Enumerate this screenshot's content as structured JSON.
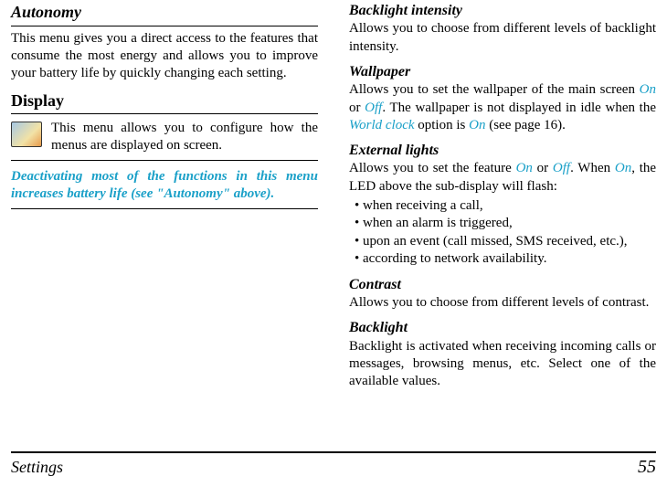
{
  "left": {
    "autonomy_heading": "Autonomy",
    "autonomy_body": "This menu gives you a direct access to the features that consume the most energy and allows you to improve your battery life by quickly changing each setting.",
    "display_heading": "Display",
    "display_callout": "This menu allows you to configure how the menus are displayed on screen.",
    "display_note": "Deactivating most of the functions in this menu increases battery life (see \"Autonomy\" above)."
  },
  "right": {
    "backlight_intensity": {
      "heading": "Backlight intensity",
      "body": "Allows you to choose from different levels of backlight intensity."
    },
    "wallpaper": {
      "heading": "Wallpaper",
      "body_pre": "Allows you to set the wallpaper of the main screen ",
      "on": "On",
      "mid1": " or ",
      "off": "Off",
      "body_mid": ". The wallpaper is not displayed in idle when the ",
      "world_clock": "World clock",
      "mid2": " option is ",
      "on2": "On",
      "body_post": " (see page 16)."
    },
    "external_lights": {
      "heading": "External lights",
      "pre": "Allows you to set the feature ",
      "on": "On",
      "mid": " or ",
      "off": "Off",
      "post1": ". When ",
      "on2": "On",
      "post2": ", the LED above the sub-display will flash:",
      "items": [
        "when receiving a call,",
        "when an alarm is triggered,",
        "upon an event (call missed, SMS received, etc.),",
        "according to network availability."
      ]
    },
    "contrast": {
      "heading": "Contrast",
      "body": "Allows you to choose from different levels of contrast."
    },
    "backlight": {
      "heading": "Backlight",
      "body": "Backlight is activated when receiving incoming calls or messages, browsing menus, etc. Select one of the available values."
    }
  },
  "footer": {
    "section": "Settings",
    "page": "55"
  }
}
